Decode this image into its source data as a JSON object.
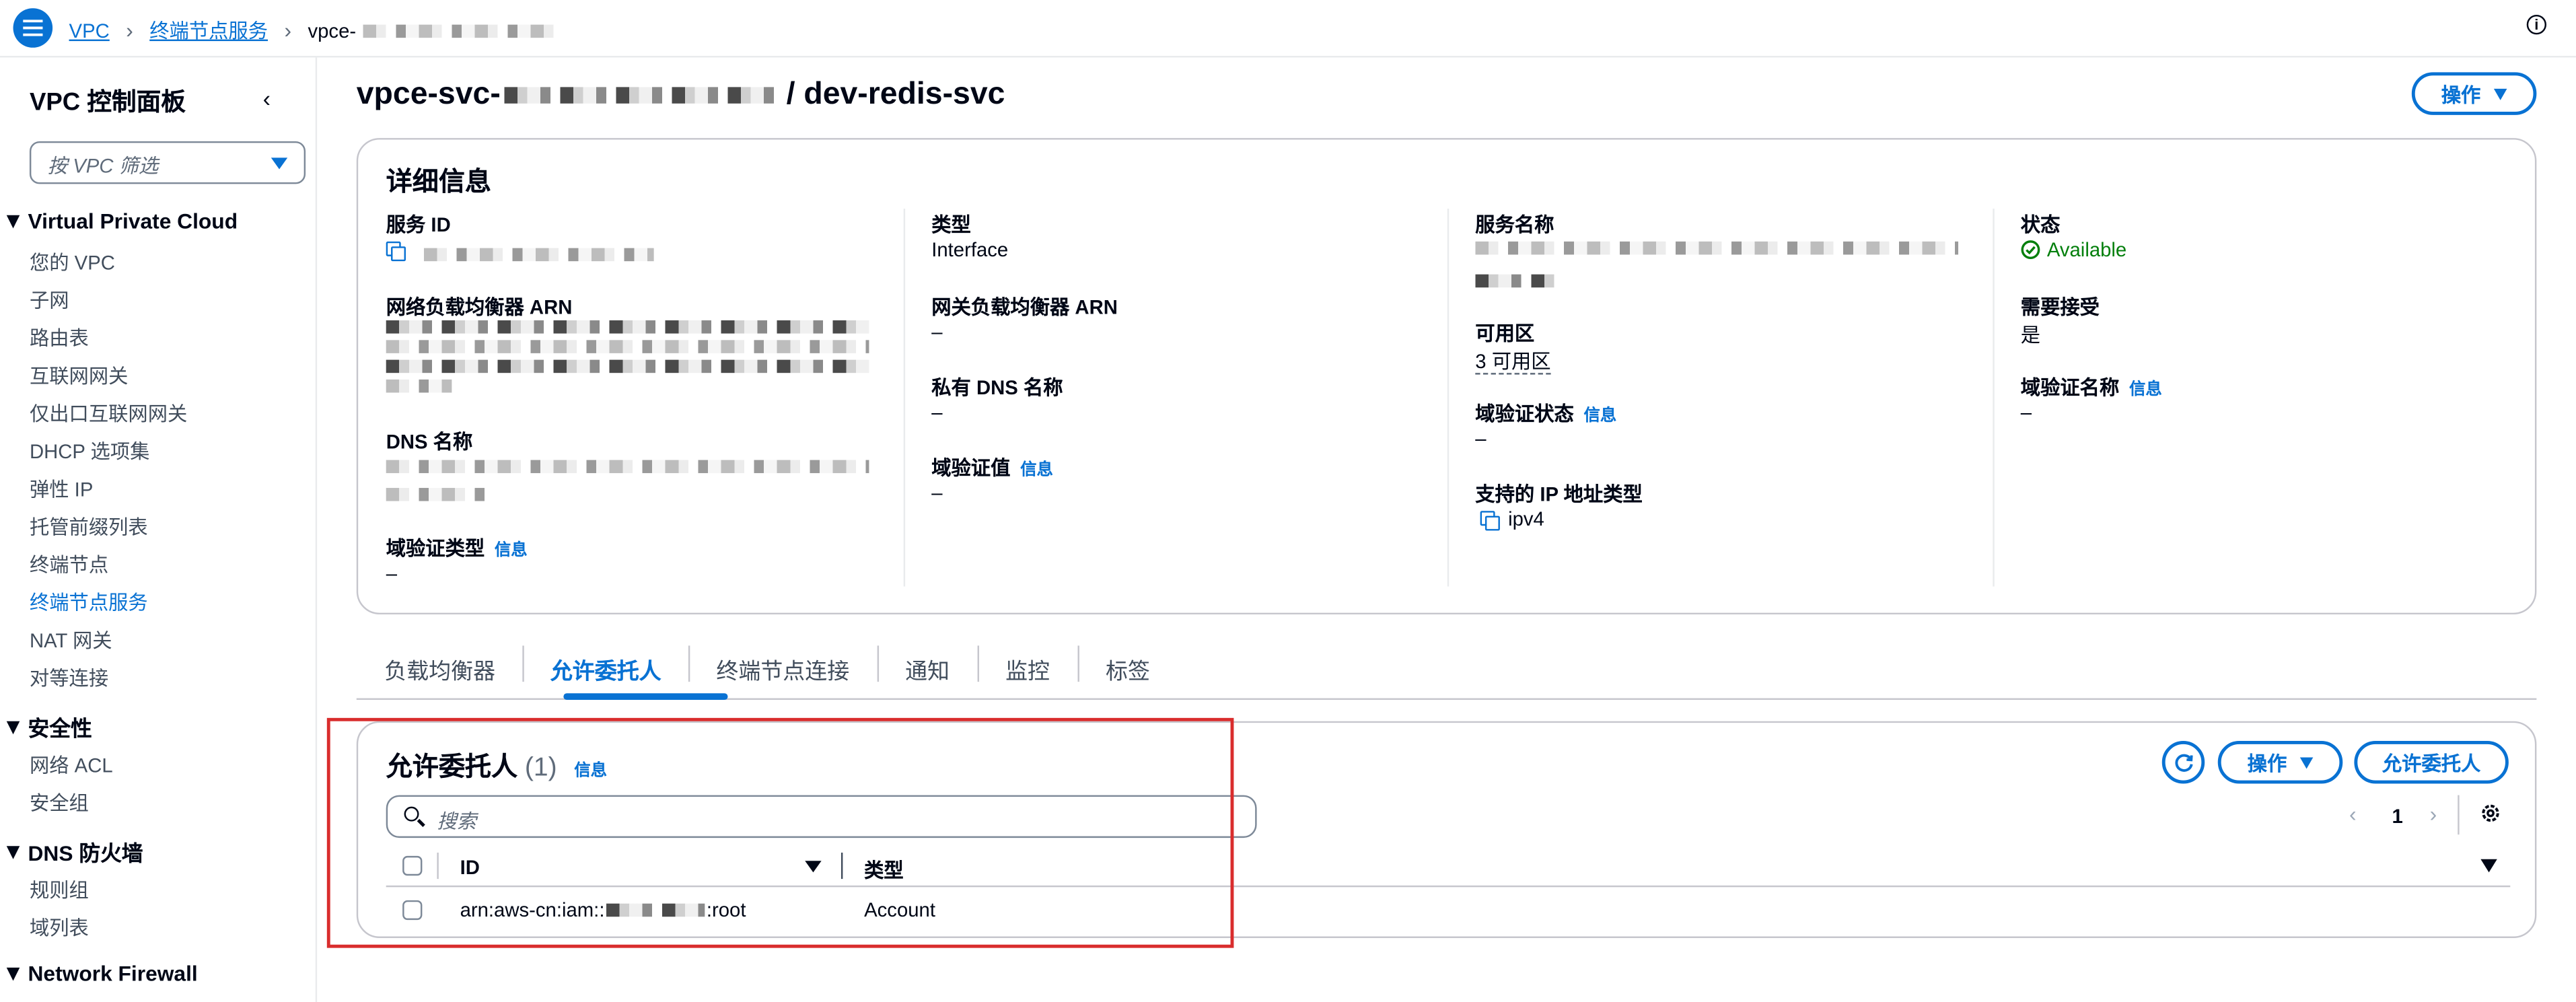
{
  "topbar": {
    "breadcrumbs": [
      "VPC",
      "终端节点服务",
      "vpce-"
    ]
  },
  "sidebar": {
    "title": "VPC 控制面板",
    "filter_placeholder": "按 VPC 筛选",
    "sections": [
      {
        "label": "Virtual Private Cloud",
        "items": [
          "您的 VPC",
          "子网",
          "路由表",
          "互联网网关",
          "仅出口互联网网关",
          "DHCP 选项集",
          "弹性 IP",
          "托管前缀列表",
          "终端节点",
          "终端节点服务",
          "NAT 网关",
          "对等连接"
        ]
      },
      {
        "label": "安全性",
        "items": [
          "网络 ACL",
          "安全组"
        ]
      },
      {
        "label": "DNS 防火墙",
        "items": [
          "规则组",
          "域列表"
        ]
      },
      {
        "label": "Network Firewall",
        "items": []
      }
    ],
    "active_item": "终端节点服务"
  },
  "page": {
    "title_prefix": "vpce-svc-",
    "title_suffix": "/ dev-redis-svc",
    "actions_label": "操作"
  },
  "details": {
    "header": "详细信息",
    "info_link": "信息",
    "fields": {
      "service_id_label": "服务 ID",
      "nlb_arn_label": "网络负载均衡器 ARN",
      "dns_name_label": "DNS 名称",
      "domain_verif_type_label": "域验证类型",
      "domain_verif_type_value": "–",
      "type_label": "类型",
      "type_value": "Interface",
      "gwlb_arn_label": "网关负载均衡器 ARN",
      "gwlb_arn_value": "–",
      "private_dns_label": "私有 DNS 名称",
      "private_dns_value": "–",
      "domain_verif_value_label": "域验证值",
      "domain_verif_value_value": "–",
      "service_name_label": "服务名称",
      "az_label": "可用区",
      "az_value": "3 可用区",
      "domain_verif_status_label": "域验证状态",
      "domain_verif_status_value": "–",
      "ip_type_label": "支持的 IP 地址类型",
      "ip_type_value": "ipv4",
      "state_label": "状态",
      "state_value": "Available",
      "accept_label": "需要接受",
      "accept_value": "是",
      "domain_verif_name_label": "域验证名称",
      "domain_verif_name_value": "–"
    }
  },
  "tabs": [
    "负载均衡器",
    "允许委托人",
    "终端节点连接",
    "通知",
    "监控",
    "标签"
  ],
  "active_tab": "允许委托人",
  "principals": {
    "header": "允许委托人",
    "count": "(1)",
    "info_link": "信息",
    "actions_label": "操作",
    "allow_button": "允许委托人",
    "search_placeholder": "搜索",
    "page_number": "1",
    "columns": [
      "ID",
      "类型"
    ],
    "rows": [
      {
        "id_prefix": "arn:aws-cn:iam::",
        "id_suffix": ":root",
        "type": "Account"
      }
    ]
  },
  "colors": {
    "accent": "#0972d3",
    "success": "#037f0c",
    "highlight": "#d92d2d"
  },
  "icons": [
    "hamburger-menu-icon",
    "chevron-right-icon",
    "info-icon",
    "chevron-left-icon",
    "caret-down-icon",
    "copy-icon",
    "check-circle-icon",
    "refresh-icon",
    "search-icon",
    "gear-icon"
  ]
}
